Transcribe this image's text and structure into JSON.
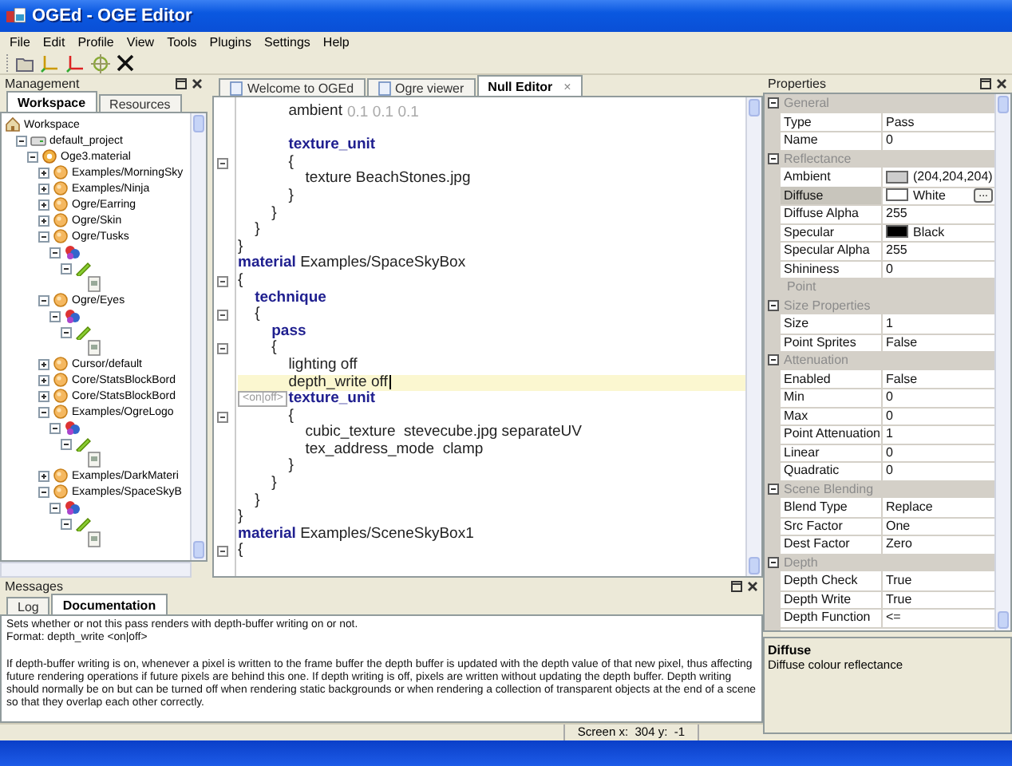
{
  "window": {
    "title": "OGEd - OGE Editor"
  },
  "menu": [
    "File",
    "Edit",
    "Profile",
    "View",
    "Tools",
    "Plugins",
    "Settings",
    "Help"
  ],
  "management": {
    "title": "Management",
    "tabs": [
      {
        "label": "Workspace",
        "selected": true
      },
      {
        "label": "Resources",
        "selected": false
      }
    ],
    "tree": [
      {
        "label": "Workspace",
        "kind": "workspace",
        "children": [
          {
            "label": "default_project",
            "kind": "project",
            "expanded": true,
            "children": [
              {
                "label": "Oge3.material",
                "kind": "file",
                "expanded": true,
                "children": [
                  {
                    "label": "Examples/MorningSky",
                    "kind": "material",
                    "expanded": false
                  },
                  {
                    "label": "Examples/Ninja",
                    "kind": "material",
                    "expanded": false
                  },
                  {
                    "label": "Ogre/Earring",
                    "kind": "material",
                    "expanded": false
                  },
                  {
                    "label": "Ogre/Skin",
                    "kind": "material",
                    "expanded": false
                  },
                  {
                    "label": "Ogre/Tusks",
                    "kind": "material",
                    "expanded": true,
                    "children": [
                      {
                        "kind": "technique",
                        "expanded": true,
                        "children": [
                          {
                            "kind": "pass",
                            "expanded": true,
                            "children": [
                              {
                                "kind": "texture"
                              }
                            ]
                          }
                        ]
                      }
                    ]
                  },
                  {
                    "label": "Ogre/Eyes",
                    "kind": "material",
                    "expanded": true,
                    "children": [
                      {
                        "kind": "technique",
                        "expanded": true,
                        "children": [
                          {
                            "kind": "pass",
                            "expanded": true,
                            "children": [
                              {
                                "kind": "texture"
                              }
                            ]
                          }
                        ]
                      }
                    ]
                  },
                  {
                    "label": "Cursor/default",
                    "kind": "material",
                    "expanded": false
                  },
                  {
                    "label": "Core/StatsBlockBord",
                    "kind": "material",
                    "expanded": false
                  },
                  {
                    "label": "Core/StatsBlockBord",
                    "kind": "material",
                    "expanded": false
                  },
                  {
                    "label": "Examples/OgreLogo",
                    "kind": "material",
                    "expanded": true,
                    "children": [
                      {
                        "kind": "technique",
                        "expanded": true,
                        "children": [
                          {
                            "kind": "pass",
                            "expanded": true,
                            "children": [
                              {
                                "kind": "texture"
                              }
                            ]
                          }
                        ]
                      }
                    ]
                  },
                  {
                    "label": "Examples/DarkMateri",
                    "kind": "material",
                    "expanded": false
                  },
                  {
                    "label": "Examples/SpaceSkyB",
                    "kind": "material",
                    "expanded": true,
                    "children": [
                      {
                        "kind": "technique",
                        "expanded": true,
                        "children": [
                          {
                            "kind": "pass",
                            "expanded": true,
                            "children": [
                              {
                                "kind": "texture"
                              }
                            ]
                          }
                        ]
                      }
                    ]
                  }
                ]
              }
            ]
          }
        ]
      }
    ]
  },
  "editor": {
    "tabs": [
      {
        "label": "Welcome to OGEd",
        "selected": false
      },
      {
        "label": "Ogre viewer",
        "selected": false
      },
      {
        "label": "Null Editor",
        "selected": true,
        "close": "×"
      }
    ],
    "tooltip": "<on|off>",
    "lines": [
      {
        "kind": "code",
        "code": "            ambient",
        "value": "0.1 0.1 0.1",
        "current": false,
        "fold": false
      },
      {
        "kind": "blank",
        "current": false,
        "fold": false
      },
      {
        "kind": "code",
        "code": "            **texture_unit**",
        "current": false,
        "fold": false
      },
      {
        "kind": "code",
        "code": "            {",
        "current": false,
        "fold": true
      },
      {
        "kind": "code",
        "code": "                texture BeachStones.jpg",
        "current": false,
        "fold": false
      },
      {
        "kind": "code",
        "code": "            }",
        "current": false,
        "fold": false
      },
      {
        "kind": "code",
        "code": "        }",
        "current": false,
        "fold": false
      },
      {
        "kind": "code",
        "code": "    }",
        "current": false,
        "fold": false
      },
      {
        "kind": "code",
        "code": "}",
        "current": false,
        "fold": false
      },
      {
        "kind": "code",
        "code": "**material** Examples/SpaceSkyBox",
        "current": false,
        "fold": false
      },
      {
        "kind": "code",
        "code": "{",
        "current": false,
        "fold": true
      },
      {
        "kind": "code",
        "code": "    **technique**",
        "current": false,
        "fold": false
      },
      {
        "kind": "code",
        "code": "    {",
        "current": false,
        "fold": true
      },
      {
        "kind": "code",
        "code": "        **pass**",
        "current": false,
        "fold": false
      },
      {
        "kind": "code",
        "code": "        {",
        "current": false,
        "fold": true
      },
      {
        "kind": "code",
        "code": "            lighting off",
        "current": false,
        "fold": false
      },
      {
        "kind": "code",
        "code": "            depth_write off",
        "current": true,
        "fold": false
      },
      {
        "kind": "code",
        "code": "            **texture_unit**",
        "current": false,
        "fold": false
      },
      {
        "kind": "code",
        "code": "            {",
        "current": false,
        "fold": true
      },
      {
        "kind": "code",
        "code": "                cubic_texture  stevecube.jpg separateUV",
        "current": false,
        "fold": false
      },
      {
        "kind": "code",
        "code": "                tex_address_mode  clamp",
        "current": false,
        "fold": false
      },
      {
        "kind": "code",
        "code": "            }",
        "current": false,
        "fold": false
      },
      {
        "kind": "code",
        "code": "        }",
        "current": false,
        "fold": false
      },
      {
        "kind": "code",
        "code": "    }",
        "current": false,
        "fold": false
      },
      {
        "kind": "code",
        "code": "}",
        "current": false,
        "fold": false
      },
      {
        "kind": "code",
        "code": "**material** Examples/SceneSkyBox1",
        "current": false,
        "fold": false
      },
      {
        "kind": "code",
        "code": "{",
        "current": false,
        "fold": true
      }
    ]
  },
  "messages": {
    "title": "Messages",
    "tabs": [
      {
        "label": "Log",
        "selected": false
      },
      {
        "label": "Documentation",
        "selected": true
      }
    ],
    "paragraphs": [
      {
        "lines": [
          "Sets whether or not this pass renders with depth-buffer writing on or not.",
          "Format: depth_write <on|off>"
        ]
      },
      {
        "lines": [
          "If depth-buffer writing is on, whenever a pixel is written to the frame buffer the depth buffer is updated with the depth value of that new pixel, thus affecting future rendering operations if future pixels are behind this one. If depth writing is off, pixels are written without updating the depth buffer. Depth writing should normally be on but can be turned off when rendering static backgrounds or when rendering a collection of transparent objects at the end of a scene so that they overlap each other correctly."
        ]
      }
    ]
  },
  "status_bar": {
    "position": "Screen x:  304 y:  -1"
  },
  "properties": {
    "title": "Properties",
    "sections": [
      {
        "kind": "category",
        "title": "General",
        "expanded": true,
        "rows": [
          {
            "name": "Type",
            "value": "Pass",
            "selected": false
          },
          {
            "name": "Name",
            "value": "0",
            "selected": false
          }
        ]
      },
      {
        "kind": "category",
        "title": "Reflectance",
        "expanded": true,
        "rows": [
          {
            "name": "Ambient",
            "value": "(204,204,204)",
            "color": "#cccccc",
            "selected": false
          },
          {
            "name": "Diffuse",
            "value": "White",
            "color": "#ffffff",
            "button": "...",
            "selected": true
          },
          {
            "name": "Diffuse Alpha",
            "value": "255",
            "selected": false
          },
          {
            "name": "Specular",
            "value": "Black",
            "color": "#000000",
            "selected": false
          },
          {
            "name": "Specular Alpha",
            "value": "255",
            "selected": false
          },
          {
            "name": "Shininess",
            "value": "0",
            "selected": false
          }
        ]
      },
      {
        "kind": "label",
        "title": "Point"
      },
      {
        "kind": "category",
        "title": "Size Properties",
        "expanded": true,
        "rows": [
          {
            "name": "Size",
            "value": "1",
            "selected": false
          },
          {
            "name": "Point Sprites",
            "value": "False",
            "selected": false
          }
        ]
      },
      {
        "kind": "category",
        "title": "Attenuation",
        "expanded": true,
        "rows": [
          {
            "name": "Enabled",
            "value": "False",
            "selected": false
          },
          {
            "name": "Min",
            "value": "0",
            "selected": false
          },
          {
            "name": "Max",
            "value": "0",
            "selected": false
          },
          {
            "name": "Point Attenuation",
            "value": "1",
            "selected": false
          },
          {
            "name": "Linear",
            "value": "0",
            "selected": false
          },
          {
            "name": "Quadratic",
            "value": "0",
            "selected": false
          }
        ]
      },
      {
        "kind": "category",
        "title": "Scene Blending",
        "expanded": true,
        "rows": [
          {
            "name": "Blend Type",
            "value": "Replace",
            "selected": false
          },
          {
            "name": "Src Factor",
            "value": "One",
            "selected": false
          },
          {
            "name": "Dest Factor",
            "value": "Zero",
            "selected": false
          }
        ]
      },
      {
        "kind": "category",
        "title": "Depth",
        "expanded": true,
        "rows": [
          {
            "name": "Depth Check",
            "value": "True",
            "selected": false
          },
          {
            "name": "Depth Write",
            "value": "True",
            "selected": false
          },
          {
            "name": "Depth Function",
            "value": "<=",
            "selected": false
          }
        ]
      }
    ],
    "description": {
      "title": "Diffuse",
      "text": "Diffuse colour reflectance"
    }
  }
}
